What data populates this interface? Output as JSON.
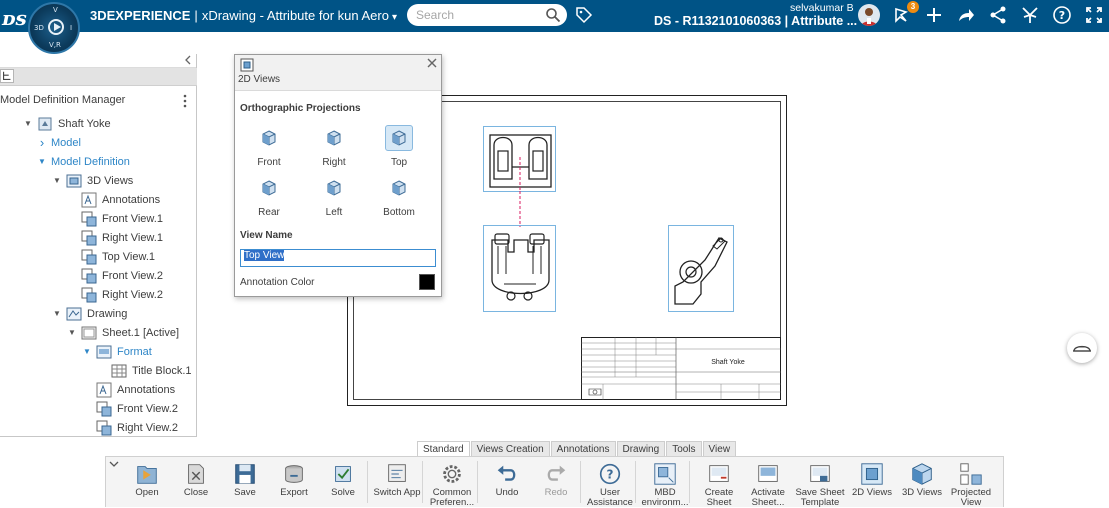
{
  "header": {
    "brand": "3DEXPERIENCE",
    "separator": "|",
    "app_name": "xDrawing - Attribute for kun Aero",
    "search_placeholder": "Search",
    "document_title": "DS - R1132101060363 | Attribute ...",
    "user_name": "selvakumar B",
    "notification_count": "3",
    "compass_labels": {
      "top": "V",
      "left": "3D",
      "right": "I",
      "bottom": "V,R"
    }
  },
  "left_panel": {
    "title": "Model Definition Manager",
    "tree": [
      {
        "label": "Shaft Yoke",
        "level": 0,
        "toggle": "down",
        "icon": "product-icon",
        "color": "normal"
      },
      {
        "label": "Model",
        "level": 1,
        "toggle": "right",
        "icon": "",
        "color": "blue"
      },
      {
        "label": "Model Definition",
        "level": 1,
        "toggle": "down",
        "icon": "",
        "color": "blue"
      },
      {
        "label": "3D Views",
        "level": 2,
        "toggle": "down",
        "icon": "views-3d-icon",
        "color": "normal"
      },
      {
        "label": "Annotations",
        "level": 3,
        "toggle": "",
        "icon": "annotation-icon",
        "color": "normal"
      },
      {
        "label": "Front View.1",
        "level": 3,
        "toggle": "",
        "icon": "view-icon",
        "color": "normal"
      },
      {
        "label": "Right View.1",
        "level": 3,
        "toggle": "",
        "icon": "view-icon",
        "color": "normal"
      },
      {
        "label": "Top View.1",
        "level": 3,
        "toggle": "",
        "icon": "view-icon",
        "color": "normal"
      },
      {
        "label": "Front View.2",
        "level": 3,
        "toggle": "",
        "icon": "view-icon",
        "color": "normal"
      },
      {
        "label": "Right View.2",
        "level": 3,
        "toggle": "",
        "icon": "view-icon",
        "color": "normal"
      },
      {
        "label": "Drawing",
        "level": 2,
        "toggle": "down",
        "icon": "drawing-icon",
        "color": "normal"
      },
      {
        "label": "Sheet.1 [Active]",
        "level": 3,
        "toggle": "down",
        "icon": "sheet-icon",
        "color": "normal"
      },
      {
        "label": "Format",
        "level": 4,
        "toggle": "down",
        "icon": "format-icon",
        "color": "blue"
      },
      {
        "label": "Title Block.1",
        "level": 5,
        "toggle": "",
        "icon": "table-icon",
        "color": "normal"
      },
      {
        "label": "Annotations",
        "level": 4,
        "toggle": "",
        "icon": "annotation-icon",
        "color": "normal"
      },
      {
        "label": "Front View.2",
        "level": 4,
        "toggle": "",
        "icon": "view-icon",
        "color": "normal"
      },
      {
        "label": "Right View.2",
        "level": 4,
        "toggle": "",
        "icon": "view-icon",
        "color": "normal"
      }
    ]
  },
  "dialog": {
    "title": "2D Views",
    "section_title": "Orthographic Projections",
    "projections": [
      {
        "label": "Front",
        "selected": false
      },
      {
        "label": "Right",
        "selected": false
      },
      {
        "label": "Top",
        "selected": true
      },
      {
        "label": "Rear",
        "selected": false
      },
      {
        "label": "Left",
        "selected": false
      },
      {
        "label": "Bottom",
        "selected": false
      }
    ],
    "view_name_label": "View Name",
    "view_name_value": "Top View",
    "annotation_color_label": "Annotation Color",
    "annotation_color": "#000000"
  },
  "drawing": {
    "title_block_name": "Shaft Yoke"
  },
  "action_bar": {
    "tabs": [
      {
        "label": "Standard",
        "active": true
      },
      {
        "label": "Views Creation",
        "active": false
      },
      {
        "label": "Annotations",
        "active": false
      },
      {
        "label": "Drawing",
        "active": false
      },
      {
        "label": "Tools",
        "active": false
      },
      {
        "label": "View",
        "active": false
      }
    ],
    "commands": [
      {
        "label": "Open",
        "line2": "",
        "icon": "open-icon",
        "enabled": true
      },
      {
        "label": "Close",
        "line2": "",
        "icon": "close-doc-icon",
        "enabled": true
      },
      {
        "label": "Save",
        "line2": "",
        "icon": "save-icon",
        "enabled": true
      },
      {
        "label": "Export",
        "line2": "",
        "icon": "export-icon",
        "enabled": true
      },
      {
        "label": "Solve",
        "line2": "",
        "icon": "solve-icon",
        "enabled": true
      },
      {
        "label": "Switch App",
        "line2": "",
        "icon": "switch-app-icon",
        "enabled": true
      },
      {
        "label": "Common",
        "line2": "Preferen...",
        "icon": "gear-icon",
        "enabled": true
      },
      {
        "label": "Undo",
        "line2": "",
        "icon": "undo-icon",
        "enabled": true
      },
      {
        "label": "Redo",
        "line2": "",
        "icon": "redo-icon",
        "enabled": false
      },
      {
        "label": "User",
        "line2": "Assistance",
        "icon": "help-icon",
        "enabled": true
      },
      {
        "label": "MBD",
        "line2": "environm...",
        "icon": "mbd-icon",
        "enabled": true
      },
      {
        "label": "Create",
        "line2": "Sheet",
        "icon": "create-sheet-icon",
        "enabled": true
      },
      {
        "label": "Activate",
        "line2": "Sheet...",
        "icon": "activate-sheet-icon",
        "enabled": true
      },
      {
        "label": "Save Sheet",
        "line2": "Template",
        "icon": "save-template-icon",
        "enabled": true
      },
      {
        "label": "2D Views",
        "line2": "",
        "icon": "views-2d-icon",
        "enabled": true
      },
      {
        "label": "3D Views",
        "line2": "",
        "icon": "views-3d-cube-icon",
        "enabled": true
      },
      {
        "label": "Projected",
        "line2": "View",
        "icon": "projected-view-icon",
        "enabled": true
      }
    ]
  },
  "colors": {
    "topbar": "#005386",
    "accent_blue": "#2e86c7",
    "selection": "#2f6fc8",
    "view_frame": "#7ab5e0",
    "notification": "#ee8b10"
  }
}
